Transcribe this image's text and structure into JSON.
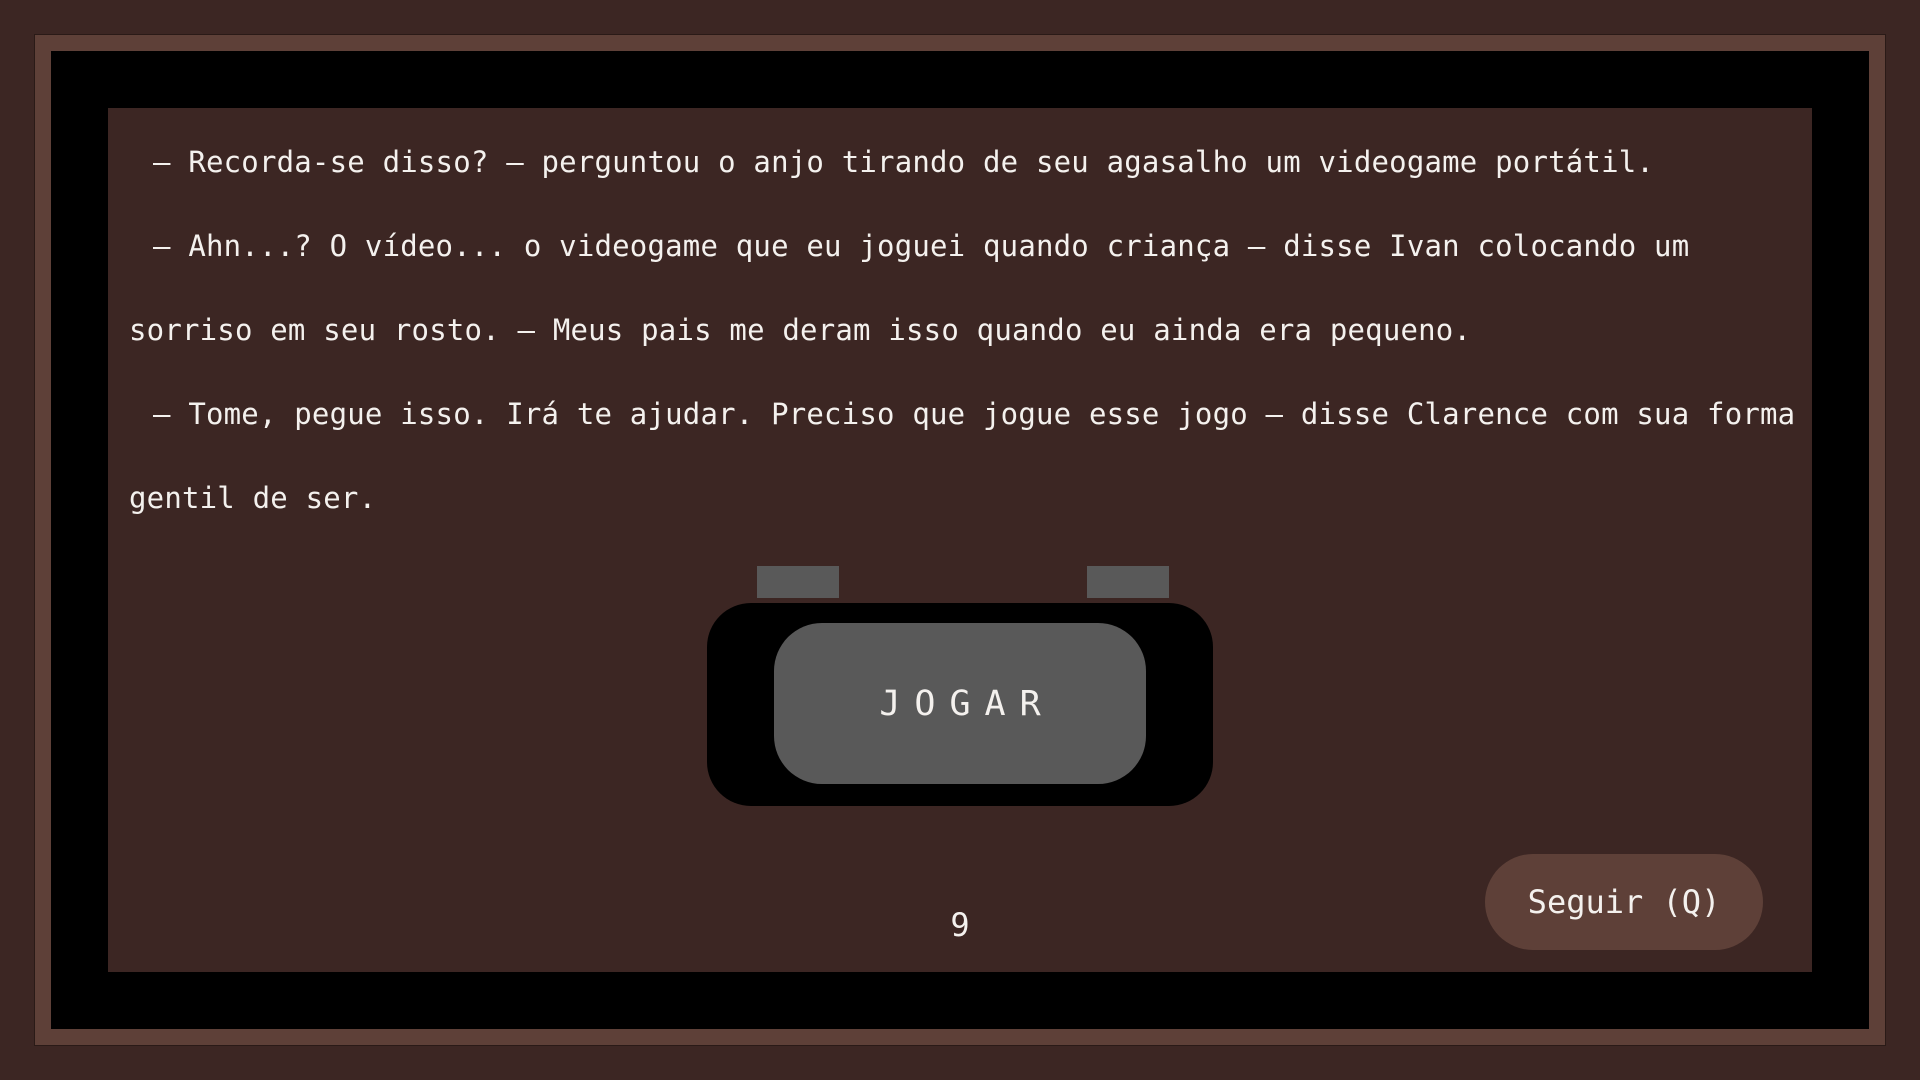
{
  "story": {
    "paragraphs": [
      "– Recorda-se disso? – perguntou o anjo tirando de seu agasalho um videogame portátil.",
      "– Ahn...? O vídeo... o videogame que eu joguei quando criança – disse Ivan colocando um sorriso em seu rosto. – Meus pais me deram isso quando eu ainda era pequeno.",
      "– Tome, pegue isso. Irá te ajudar. Preciso que jogue esse jogo – disse Clarence com sua forma gentil de ser."
    ]
  },
  "console": {
    "play_label": "JOGAR"
  },
  "footer": {
    "page_number": "9",
    "next_label": "Seguir (Q)"
  },
  "colors": {
    "background": "#3c2623",
    "frame": "#5e4038",
    "console_body": "#000000",
    "console_button": "#595959",
    "text": "#f4f1ee"
  }
}
